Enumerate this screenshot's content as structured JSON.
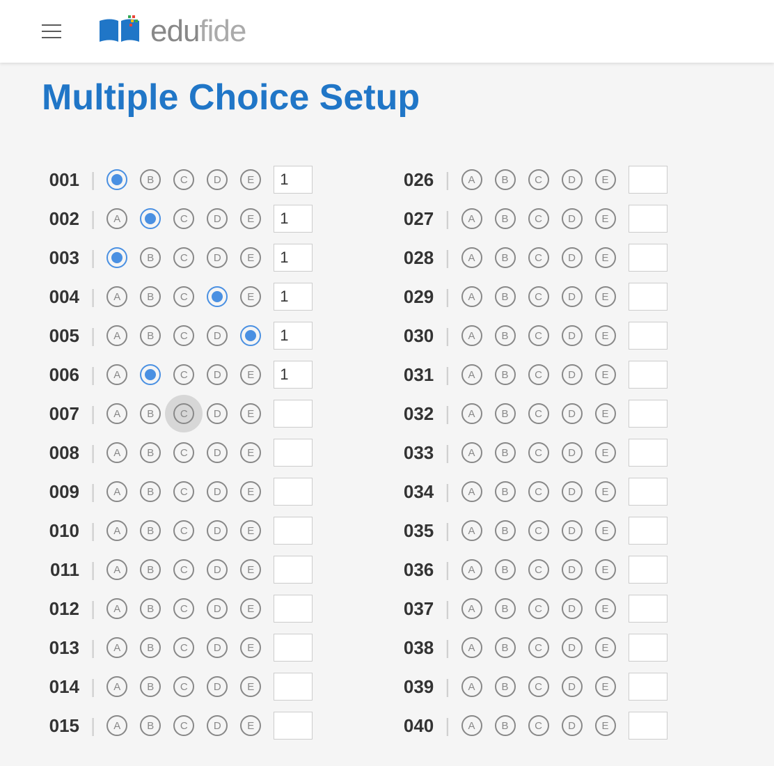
{
  "header": {
    "logo_text_edu": "edu",
    "logo_text_fide": "fide"
  },
  "page_title": "Multiple Choice Setup",
  "options": [
    "A",
    "B",
    "C",
    "D",
    "E"
  ],
  "left_questions": [
    {
      "num": "001",
      "selected": "A",
      "highlighted": null,
      "points": "1"
    },
    {
      "num": "002",
      "selected": "B",
      "highlighted": null,
      "points": "1"
    },
    {
      "num": "003",
      "selected": "A",
      "highlighted": null,
      "points": "1"
    },
    {
      "num": "004",
      "selected": "D",
      "highlighted": null,
      "points": "1"
    },
    {
      "num": "005",
      "selected": "E",
      "highlighted": null,
      "points": "1"
    },
    {
      "num": "006",
      "selected": "B",
      "highlighted": null,
      "points": "1"
    },
    {
      "num": "007",
      "selected": null,
      "highlighted": "C",
      "points": ""
    },
    {
      "num": "008",
      "selected": null,
      "highlighted": null,
      "points": ""
    },
    {
      "num": "009",
      "selected": null,
      "highlighted": null,
      "points": ""
    },
    {
      "num": "010",
      "selected": null,
      "highlighted": null,
      "points": ""
    },
    {
      "num": "011",
      "selected": null,
      "highlighted": null,
      "points": ""
    },
    {
      "num": "012",
      "selected": null,
      "highlighted": null,
      "points": ""
    },
    {
      "num": "013",
      "selected": null,
      "highlighted": null,
      "points": ""
    },
    {
      "num": "014",
      "selected": null,
      "highlighted": null,
      "points": ""
    },
    {
      "num": "015",
      "selected": null,
      "highlighted": null,
      "points": ""
    }
  ],
  "right_questions": [
    {
      "num": "026",
      "selected": null,
      "highlighted": null,
      "points": ""
    },
    {
      "num": "027",
      "selected": null,
      "highlighted": null,
      "points": ""
    },
    {
      "num": "028",
      "selected": null,
      "highlighted": null,
      "points": ""
    },
    {
      "num": "029",
      "selected": null,
      "highlighted": null,
      "points": ""
    },
    {
      "num": "030",
      "selected": null,
      "highlighted": null,
      "points": ""
    },
    {
      "num": "031",
      "selected": null,
      "highlighted": null,
      "points": ""
    },
    {
      "num": "032",
      "selected": null,
      "highlighted": null,
      "points": ""
    },
    {
      "num": "033",
      "selected": null,
      "highlighted": null,
      "points": ""
    },
    {
      "num": "034",
      "selected": null,
      "highlighted": null,
      "points": ""
    },
    {
      "num": "035",
      "selected": null,
      "highlighted": null,
      "points": ""
    },
    {
      "num": "036",
      "selected": null,
      "highlighted": null,
      "points": ""
    },
    {
      "num": "037",
      "selected": null,
      "highlighted": null,
      "points": ""
    },
    {
      "num": "038",
      "selected": null,
      "highlighted": null,
      "points": ""
    },
    {
      "num": "039",
      "selected": null,
      "highlighted": null,
      "points": ""
    },
    {
      "num": "040",
      "selected": null,
      "highlighted": null,
      "points": ""
    }
  ]
}
